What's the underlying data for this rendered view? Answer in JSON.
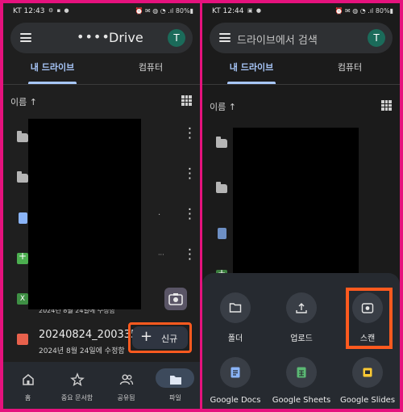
{
  "left": {
    "status": {
      "time": "KT 12:43",
      "icons": "⚙ ▪ ●",
      "battery": "⏰ ✉ ◍ ◔ .ıl 80%▮"
    },
    "topbar": {
      "dots": "••••",
      "title": "Drive",
      "avatar": "T"
    },
    "tabs": [
      {
        "label": "내 드라이브"
      },
      {
        "label": "컴퓨터"
      }
    ],
    "sort_label": "이름 ↑",
    "files": [
      {
        "type": "folder"
      },
      {
        "type": "folder"
      },
      {
        "type": "doc"
      },
      {
        "type": "sheet"
      },
      {
        "type": "excel",
        "icon_text": "X"
      },
      {
        "type": "video"
      }
    ],
    "partial_text": {
      "r3": "·",
      "r4": "···",
      "r5": "2024년 8월 24일에 수정함"
    },
    "last_file": {
      "name": "20240824_200335",
      "date": "2024년 8월 24일에 수정함"
    },
    "new_button": {
      "plus": "+",
      "label": "신규"
    },
    "nav": [
      {
        "label": "홈",
        "icon": "home-icon"
      },
      {
        "label": "중요 문서함",
        "icon": "star-icon"
      },
      {
        "label": "공유됨",
        "icon": "people-icon"
      },
      {
        "label": "파일",
        "icon": "folder-icon"
      }
    ]
  },
  "right": {
    "status": {
      "time": "KT 12:44",
      "icons": "▣ ●",
      "battery": "⏰ ✉ ◍ ◔ .ıl 80%▮"
    },
    "topbar": {
      "search_placeholder": "드라이브에서 검색",
      "avatar": "T"
    },
    "tabs": [
      {
        "label": "내 드라이브"
      },
      {
        "label": "컴퓨터"
      }
    ],
    "sort_label": "이름 ↑",
    "actions": [
      {
        "label": "폴더",
        "icon": "folder-outline-icon"
      },
      {
        "label": "업로드",
        "icon": "upload-icon"
      },
      {
        "label": "스캔",
        "icon": "camera-icon"
      },
      {
        "label": "Google Docs",
        "icon": "docs-icon"
      },
      {
        "label": "Google Sheets",
        "icon": "sheets-icon"
      },
      {
        "label": "Google Slides",
        "icon": "slides-icon"
      }
    ]
  },
  "colors": {
    "accent": "#a8c7fa",
    "highlight": "#ff5a1f",
    "frame": "#e5127d"
  }
}
